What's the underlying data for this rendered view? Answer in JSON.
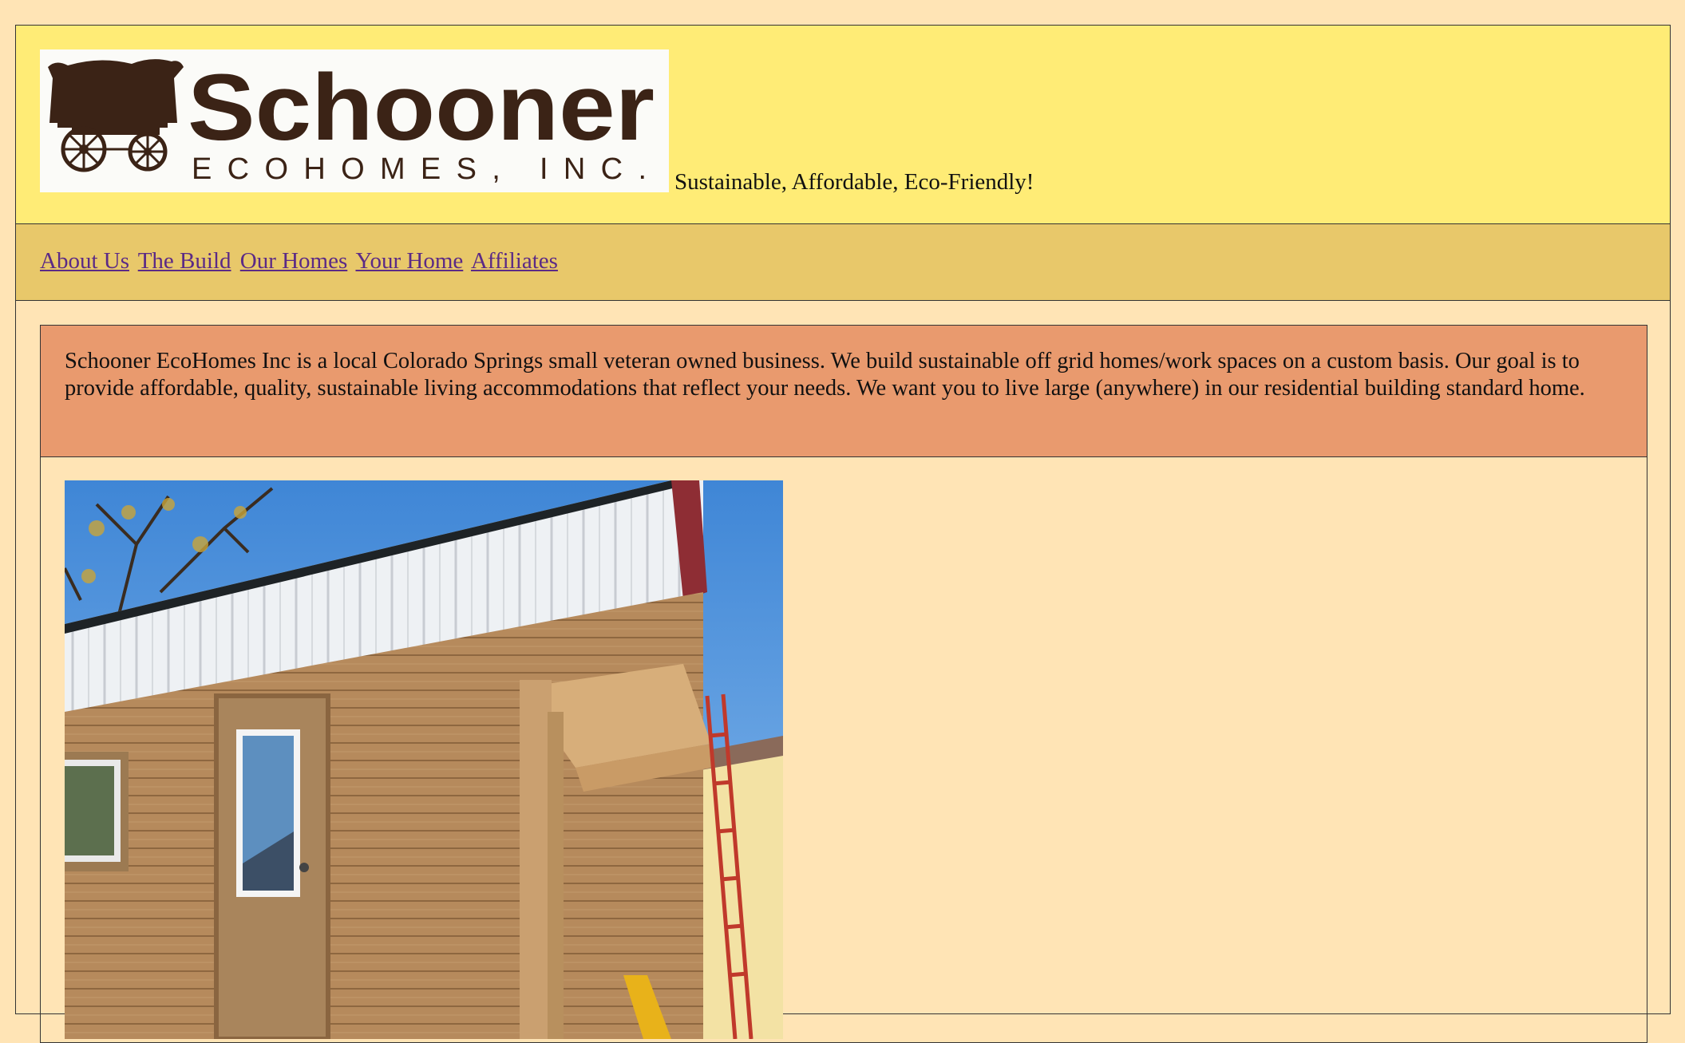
{
  "header": {
    "logo": {
      "wordmark": "Schooner",
      "subline": "ECOHOMES, INC."
    },
    "tagline": "Sustainable, Affordable, Eco-Friendly!"
  },
  "nav": {
    "items": [
      {
        "label": "About Us"
      },
      {
        "label": "The Build"
      },
      {
        "label": "Our Homes"
      },
      {
        "label": "Your Home"
      },
      {
        "label": "Affiliates"
      }
    ],
    "link_color": "#5b2a86"
  },
  "main": {
    "intro": "Schooner EcoHomes Inc is a local Colorado Springs small veteran owned business. We build sustainable off grid homes/work spaces on a custom basis. Our goal is to provide affordable, quality, sustainable living accommodations that reflect your needs. We want you to live large (anywhere) in our residential building standard home."
  },
  "colors": {
    "page_bg": "#ffe4b5",
    "header_bg": "#ffec76",
    "nav_bg": "#e8c86a",
    "intro_bg": "#e99a6e",
    "logo_brown": "#3b2316"
  }
}
